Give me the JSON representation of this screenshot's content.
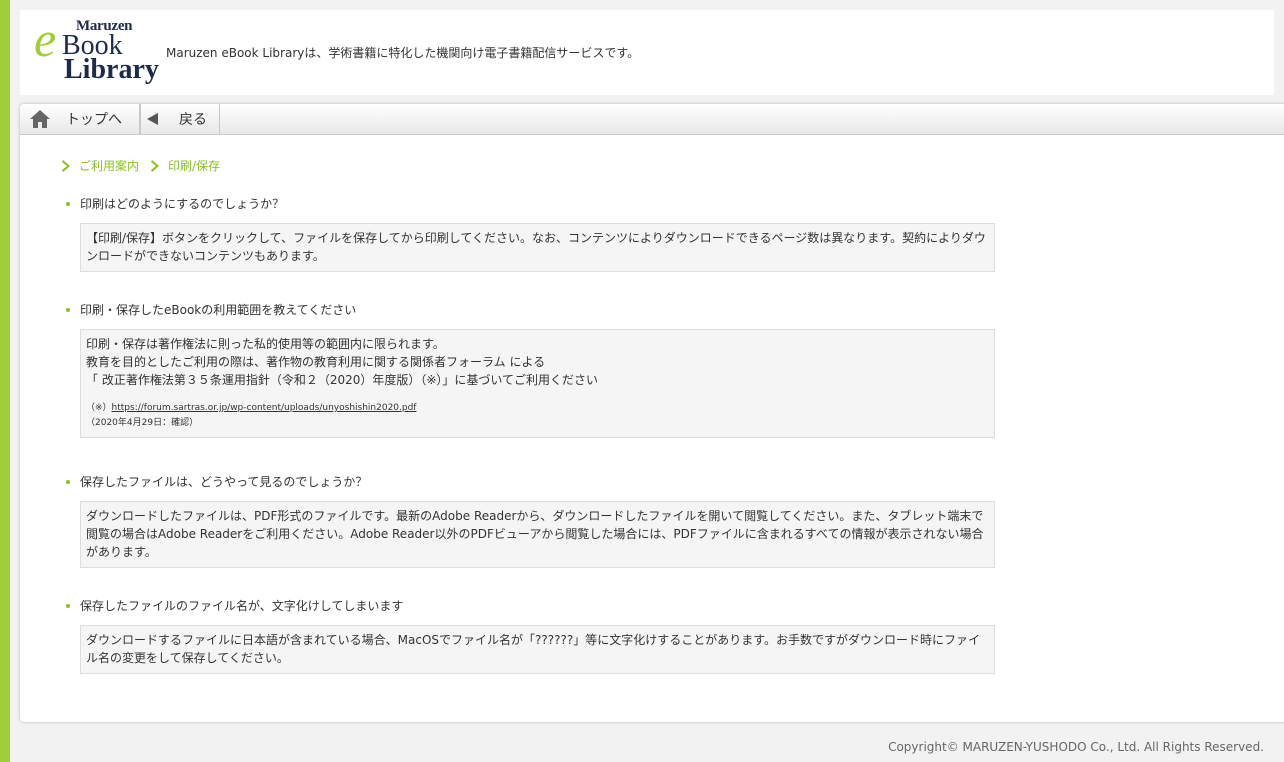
{
  "header": {
    "logo": {
      "line1": "Maruzen",
      "e": "e",
      "book": "Book",
      "library": "Library"
    },
    "tagline": "Maruzen eBook Libraryは、学術書籍に特化した機関向け電子書籍配信サービスです。"
  },
  "toolbar": {
    "home_label": "トップへ",
    "back_label": "戻る"
  },
  "breadcrumb": [
    "ご利用案内",
    "印刷/保存"
  ],
  "faq": [
    {
      "question": "印刷はどのようにするのでしょうか？",
      "answer": "【印刷/保存】ボタンをクリックして、ファイルを保存してから印刷してください。なお、コンテンツによりダウンロードできるページ数は異なります。契約によりダウンロードができないコンテンツもあります。"
    },
    {
      "question": "印刷・保存したeBookの利用範囲を教えてください",
      "answer_lines": [
        "印刷・保存は著作権法に則った私的使用等の範囲内に限られます。",
        "教育を目的としたご利用の際は、著作物の教育利用に関する関係者フォーラム による",
        "「 改正著作権法第３５条運用指針（令和２（2020）年度版）（※）」に基づいてご利用ください"
      ],
      "note_prefix": "（※）",
      "note_link": "https://forum.sartras.or.jp/wp-content/uploads/unyoshishin2020.pdf",
      "note_date": "（2020年4月29日：確認）"
    },
    {
      "question": "保存したファイルは、どうやって見るのでしょうか？",
      "answer": "ダウンロードしたファイルは、PDF形式のファイルです。最新のAdobe Readerから、ダウンロードしたファイルを開いて閲覧してください。また、タブレット端末で閲覧の場合はAdobe Readerをご利用ください。Adobe Reader以外のPDFビューアから閲覧した場合には、PDFファイルに含まれるすべての情報が表示されない場合があります。"
    },
    {
      "question": "保存したファイルのファイル名が、文字化けしてしまいます",
      "answer": "ダウンロードするファイルに日本語が含まれている場合、MacOSでファイル名が「??????」等に文字化けすることがあります。お手数ですがダウンロード時にファイル名の変更をして保存してください。"
    }
  ],
  "footer": {
    "copyright": "Copyright© MARUZEN-YUSHODO Co., Ltd. All Rights Reserved."
  },
  "colors": {
    "accent": "#a2cd3b",
    "link_green": "#8cbf26",
    "navy": "#1e2a4a"
  },
  "icons": {
    "home": "home-icon",
    "back": "triangle-left-icon",
    "breadcrumb": "chevron-right-icon"
  }
}
